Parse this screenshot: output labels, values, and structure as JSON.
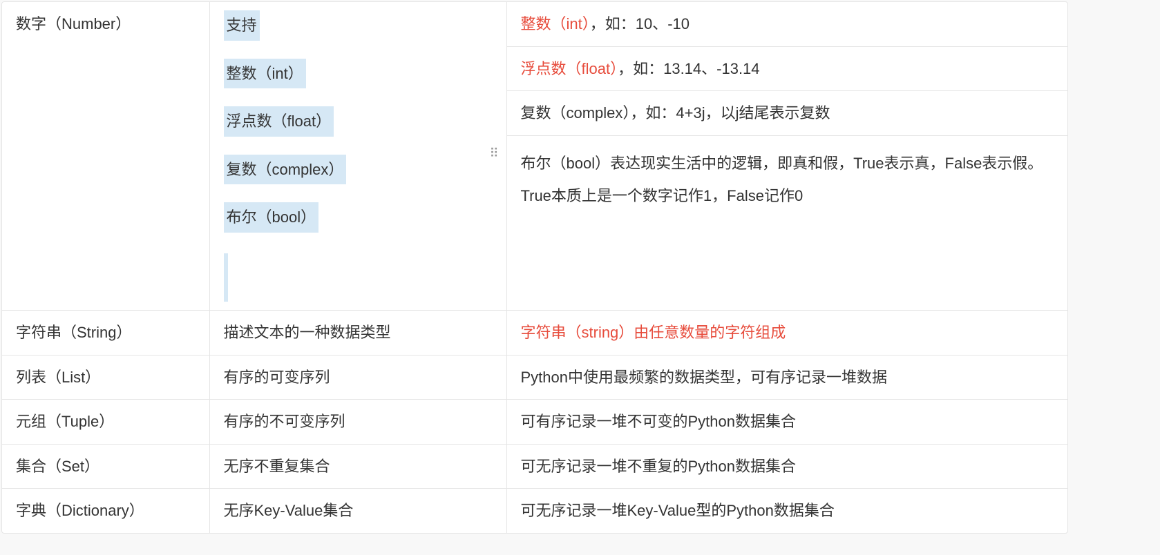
{
  "rows": {
    "number": {
      "name": "数字（Number）",
      "tags": [
        "支持",
        "整数（int）",
        "浮点数（float）",
        "复数（complex）",
        "布尔（bool）"
      ],
      "subdesc": {
        "int": {
          "red": "整数（int）",
          "rest": "，如：10、-10"
        },
        "float": {
          "red": "浮点数（float）",
          "rest": "，如：13.14、-13.14"
        },
        "complex": {
          "text": "复数（complex），如：4+3j，以j结尾表示复数"
        },
        "bool": {
          "p1": "布尔（bool）表达现实生活中的逻辑，即真和假，True表示真，False表示假。",
          "p2": "True本质上是一个数字记作1，False记作0"
        }
      }
    },
    "string": {
      "name": "字符串（String）",
      "desc": "描述文本的一种数据类型",
      "detail_red": "字符串（string）由任意数量的字符组成"
    },
    "list": {
      "name": "列表（List）",
      "desc": "有序的可变序列",
      "detail": "Python中使用最频繁的数据类型，可有序记录一堆数据"
    },
    "tuple": {
      "name": "元组（Tuple）",
      "desc": "有序的不可变序列",
      "detail": "可有序记录一堆不可变的Python数据集合"
    },
    "set": {
      "name": "集合（Set）",
      "desc": "无序不重复集合",
      "detail": "可无序记录一堆不重复的Python数据集合"
    },
    "dict": {
      "name": "字典（Dictionary）",
      "desc": "无序Key-Value集合",
      "detail": "可无序记录一堆Key-Value型的Python数据集合"
    }
  }
}
